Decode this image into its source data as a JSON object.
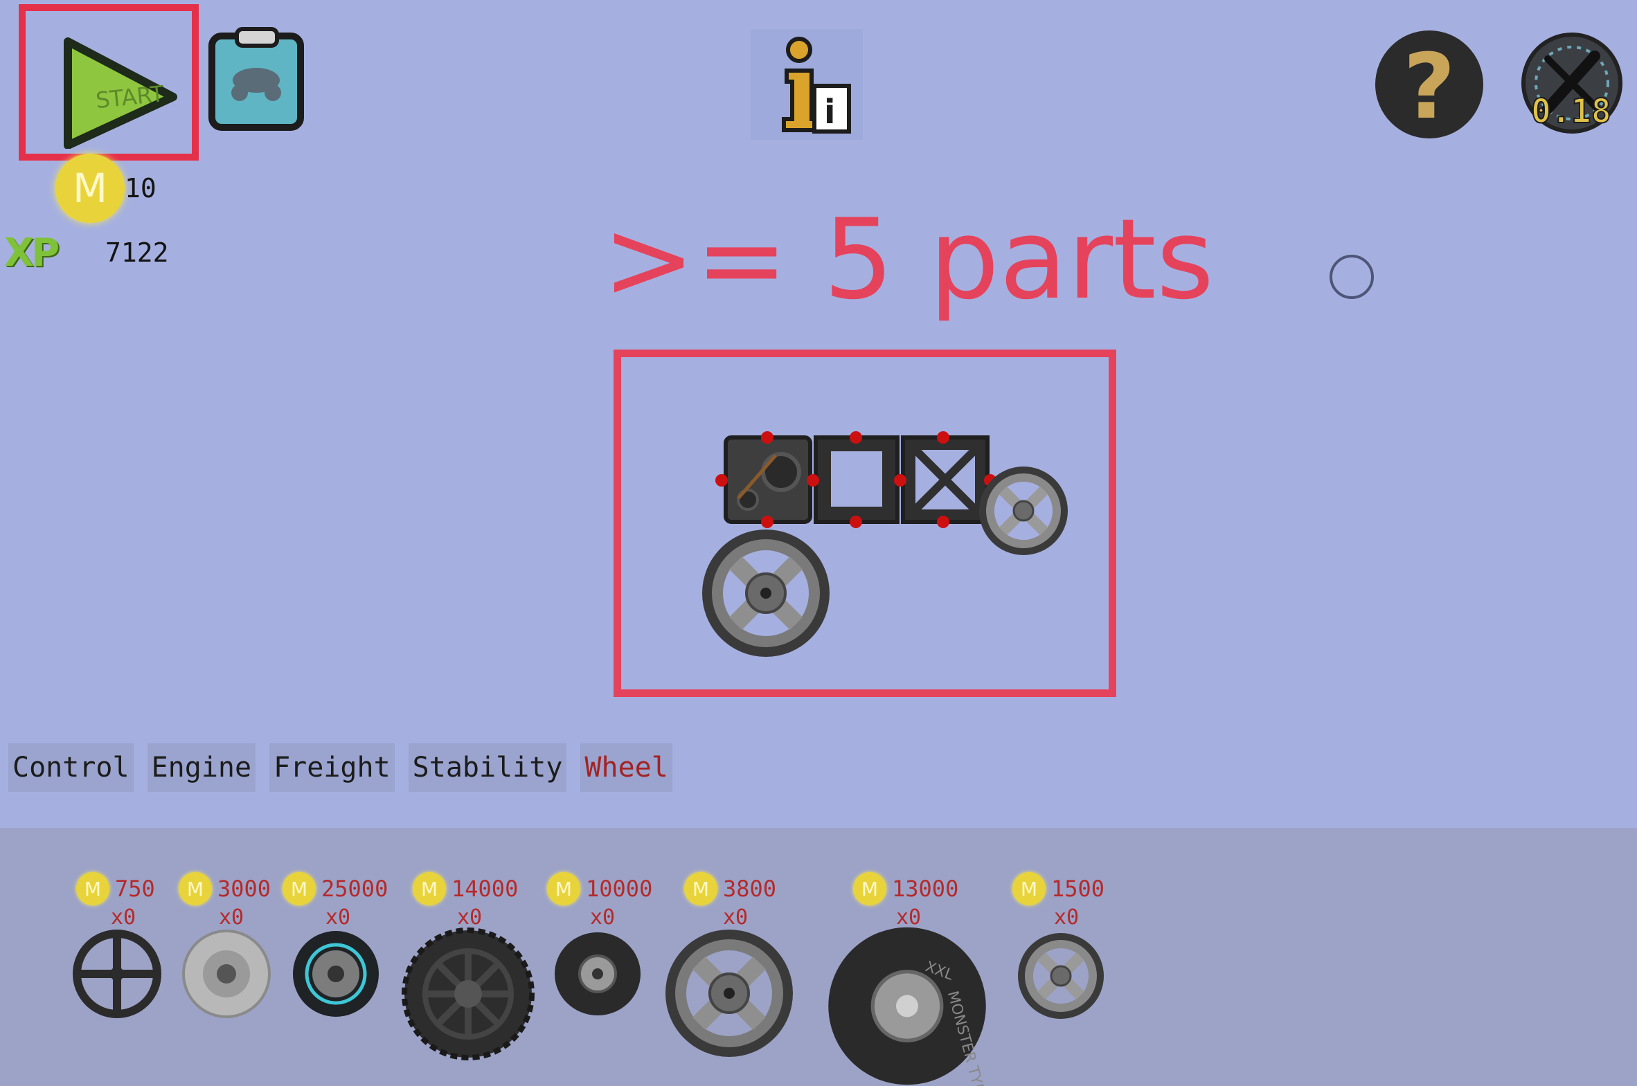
{
  "toolbar": {
    "start_label": "START",
    "info_label": "i",
    "help_label": "?",
    "version_label": "0.18"
  },
  "currency": {
    "coin_symbol": "M",
    "coins": "10",
    "xp_label": "XP",
    "xp": "7122"
  },
  "annotation": {
    "text": ">= 5 parts"
  },
  "tabs": [
    {
      "label": "Control",
      "active": false
    },
    {
      "label": "Engine",
      "active": false
    },
    {
      "label": "Freight",
      "active": false
    },
    {
      "label": "Stability",
      "active": false
    },
    {
      "label": "Wheel",
      "active": true
    }
  ],
  "parts": [
    {
      "price": "750",
      "qty": "x0",
      "icon": "steering-wheel-icon"
    },
    {
      "price": "3000",
      "qty": "x0",
      "icon": "grey-wheel-icon"
    },
    {
      "price": "25000",
      "qty": "x0",
      "icon": "racing-wheel-icon"
    },
    {
      "price": "14000",
      "qty": "x0",
      "icon": "offroad-wheel-icon"
    },
    {
      "price": "10000",
      "qty": "x0",
      "icon": "small-tire-icon"
    },
    {
      "price": "3800",
      "qty": "x0",
      "icon": "spoke-wheel-icon"
    },
    {
      "price": "13000",
      "qty": "x0",
      "icon": "monster-tyre-icon"
    },
    {
      "price": "1500",
      "qty": "x0",
      "icon": "small-spoke-wheel-icon"
    }
  ],
  "monster_tyre_text": "MONSTER TYRE",
  "monster_tyre_brand": "XXL",
  "colors": {
    "background": "#a6b0e0",
    "tray": "#9da3c7",
    "annotation": "#e5435c",
    "coin": "#e8d43a",
    "price": "#b52a2a",
    "active_tab": "#a32323"
  }
}
